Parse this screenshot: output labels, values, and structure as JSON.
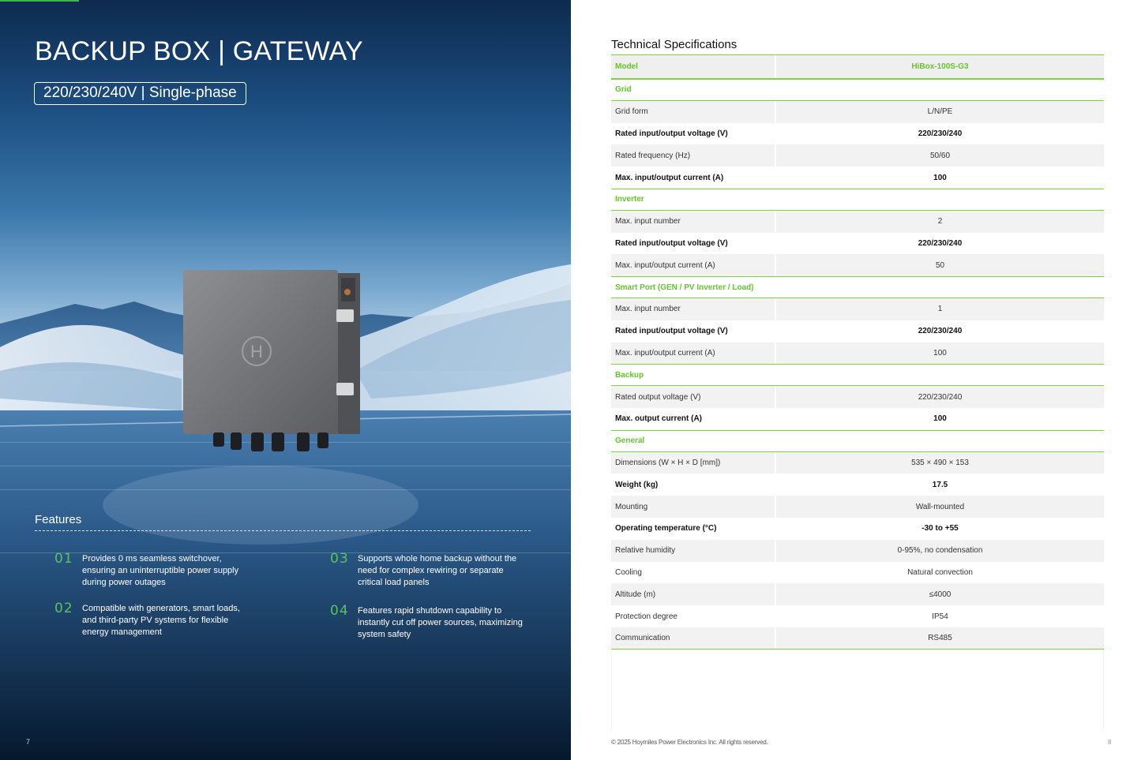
{
  "left": {
    "title": "BACKUP BOX | GATEWAY",
    "voltage": "220/230/240V | Single-phase",
    "device_logo": "H",
    "features_title": "Features",
    "features": [
      {
        "num": "01",
        "text": "Provides 0 ms seamless switchover, ensuring an uninterruptible power supply during power outages"
      },
      {
        "num": "02",
        "text": "Compatible with generators, smart loads, and third-party PV systems for flexible energy management"
      },
      {
        "num": "03",
        "text": "Supports whole home backup without the need for complex rewiring or separate critical load panels"
      },
      {
        "num": "04",
        "text": "Features rapid shutdown capability to instantly cut off power sources, maximizing system safety"
      }
    ],
    "page_number": "7"
  },
  "right": {
    "spec_title": "Technical Specifications",
    "model": {
      "label": "Model",
      "value": "HiBox-100S-G3"
    },
    "sections": [
      {
        "name": "Grid",
        "rows": [
          {
            "label": "Grid form",
            "value": "L/N/PE",
            "bold": false
          },
          {
            "label": "Rated input/output voltage (V)",
            "value": "220/230/240",
            "bold": true
          },
          {
            "label": "Rated frequency (Hz)",
            "value": "50/60",
            "bold": false
          },
          {
            "label": "Max. input/output current (A)",
            "value": "100",
            "bold": true
          }
        ]
      },
      {
        "name": "Inverter",
        "rows": [
          {
            "label": "Max. input number",
            "value": "2",
            "bold": false
          },
          {
            "label": "Rated input/output voltage (V)",
            "value": "220/230/240",
            "bold": true
          },
          {
            "label": "Max. input/output current (A)",
            "value": "50",
            "bold": false
          }
        ]
      },
      {
        "name": "Smart Port (GEN / PV Inverter / Load)",
        "rows": [
          {
            "label": "Max. input number",
            "value": "1",
            "bold": false
          },
          {
            "label": "Rated input/output voltage (V)",
            "value": "220/230/240",
            "bold": true
          },
          {
            "label": "Max. input/output current (A)",
            "value": "100",
            "bold": false
          }
        ]
      },
      {
        "name": "Backup",
        "rows": [
          {
            "label": "Rated output voltage (V)",
            "value": "220/230/240",
            "bold": false
          },
          {
            "label": "Max. output current (A)",
            "value": "100",
            "bold": true
          }
        ]
      },
      {
        "name": "General",
        "rows": [
          {
            "label": "Dimensions (W × H × D [mm])",
            "value": "535 × 490 × 153",
            "bold": false
          },
          {
            "label": "Weight (kg)",
            "value": "17.5",
            "bold": true
          },
          {
            "label": "Mounting",
            "value": "Wall-mounted",
            "bold": false
          },
          {
            "label": "Operating temperature (°C)",
            "value": "-30 to +55",
            "bold": true
          },
          {
            "label": "Relative humidity",
            "value": "0-95%, no condensation",
            "bold": false
          },
          {
            "label": "Cooling",
            "value": "Natural convection",
            "bold": false
          },
          {
            "label": "Altitude (m)",
            "value": "≤4000",
            "bold": false
          },
          {
            "label": "Protection degree",
            "value": "IP54",
            "bold": false
          },
          {
            "label": "Communication",
            "value": "RS485",
            "bold": false
          }
        ]
      }
    ],
    "copyright": "© 2025 Hoymiles Power Electronics Inc. All rights reserved.",
    "page_number": "8"
  }
}
